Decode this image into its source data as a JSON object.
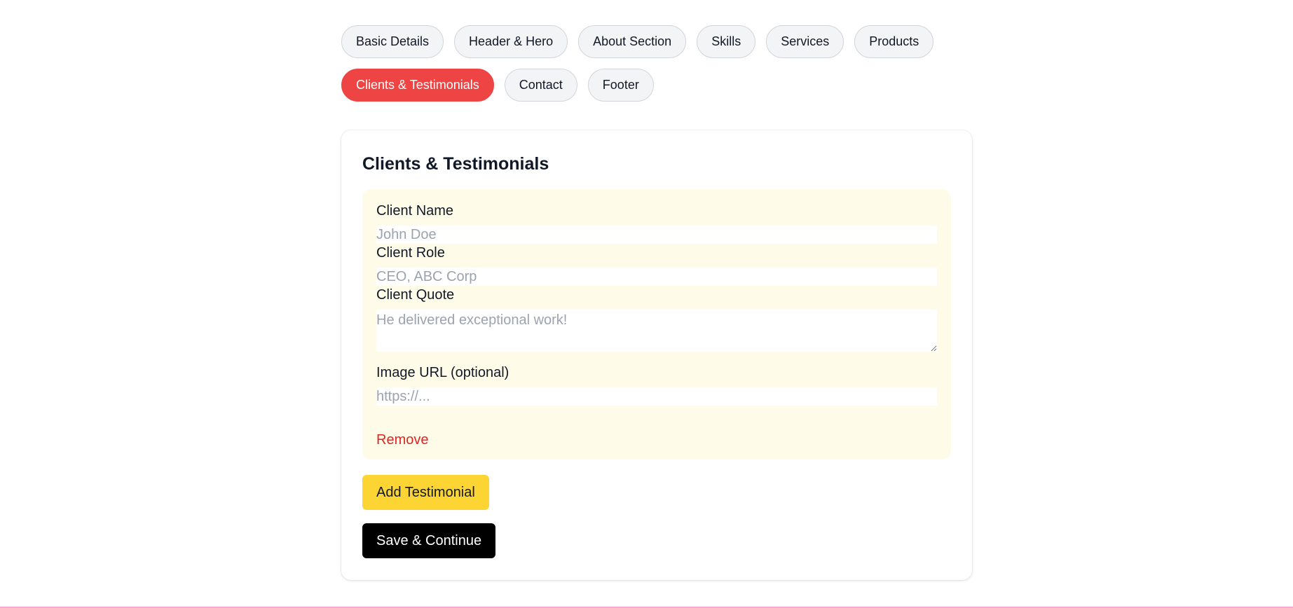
{
  "tabs": {
    "row1": [
      "Basic Details",
      "Header & Hero",
      "About Section",
      "Skills",
      "Services",
      "Products"
    ],
    "row2": [
      "Clients & Testimonials",
      "Contact",
      "Footer"
    ],
    "active": "Clients & Testimonials"
  },
  "section": {
    "title": "Clients & Testimonials",
    "testimonial": {
      "client_name_label": "Client Name",
      "client_name_placeholder": "John Doe",
      "client_name_value": "",
      "client_role_label": "Client Role",
      "client_role_placeholder": "CEO, ABC Corp",
      "client_role_value": "",
      "client_quote_label": "Client Quote",
      "client_quote_placeholder": "He delivered exceptional work!",
      "client_quote_value": "",
      "image_url_label": "Image URL (optional)",
      "image_url_placeholder": "https://...",
      "image_url_value": "",
      "remove_label": "Remove"
    },
    "add_button_label": "Add Testimonial",
    "save_button_label": "Save & Continue"
  },
  "colors": {
    "active_tab": "#ef4444",
    "entry_background": "#fefce8",
    "add_button": "#fcd535",
    "save_button": "#000000",
    "remove_text": "#dc2626"
  }
}
